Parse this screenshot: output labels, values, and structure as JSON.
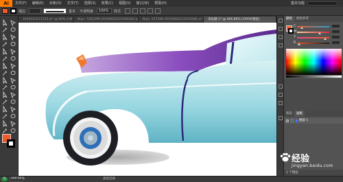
{
  "app": {
    "logo": "Ai",
    "menu": [
      "文件(F)",
      "编辑(E)",
      "对象(O)",
      "文字(T)",
      "选择(S)",
      "效果(C)",
      "视图(V)",
      "窗口(W)",
      "帮助(H)"
    ],
    "workspace": "基本功能"
  },
  "control_bar": {
    "label_stroke": "描边",
    "style_label": "基本",
    "opacity_label": "不透明度",
    "opacity_value": "100%",
    "style_word": "样式",
    "fill_color": "#f25a2b"
  },
  "tabs": [
    {
      "label": "1919103113123.ai* @ 80% (CMYK/预览)",
      "active": false
    },
    {
      "label": "Nips: 7262299 20190920103300240.ai*",
      "active": false
    },
    {
      "label": "Nips: 537398 20190920215016080.ai*",
      "active": false
    },
    {
      "label": "未标题-1* @ 466.86% (CMYK/预览)",
      "active": true
    }
  ],
  "toolbar": {
    "fill_color": "#f25a2b",
    "stroke_color": "#000000"
  },
  "color_panel": {
    "tabs": [
      "颜色",
      "颜色参考"
    ],
    "sliders": [
      {
        "label": "C",
        "color": "#f25a2b"
      },
      {
        "label": "M",
        "color": "#f25a2b"
      },
      {
        "label": "Y",
        "color": "#f25a2b"
      },
      {
        "label": "K",
        "color": "#f25a2b"
      }
    ]
  },
  "layers_panel": {
    "tabs": [
      "图层",
      "画板"
    ],
    "layer_name": "图层 1",
    "footer": "1 个图层"
  },
  "status": {
    "brand": "S",
    "zoom": "466.86%",
    "tool": "直接选择"
  },
  "watermark": {
    "brand": "经验",
    "url": "jingyan.baidu.com"
  },
  "colors": {
    "car_body": "#8fd3dd",
    "car_roof": "#7c3fa6",
    "tire": "#1d1f24",
    "hubcap": "#2e6fb8",
    "shadow": "#bdbdbd",
    "headlight": "#ef7a2e"
  }
}
